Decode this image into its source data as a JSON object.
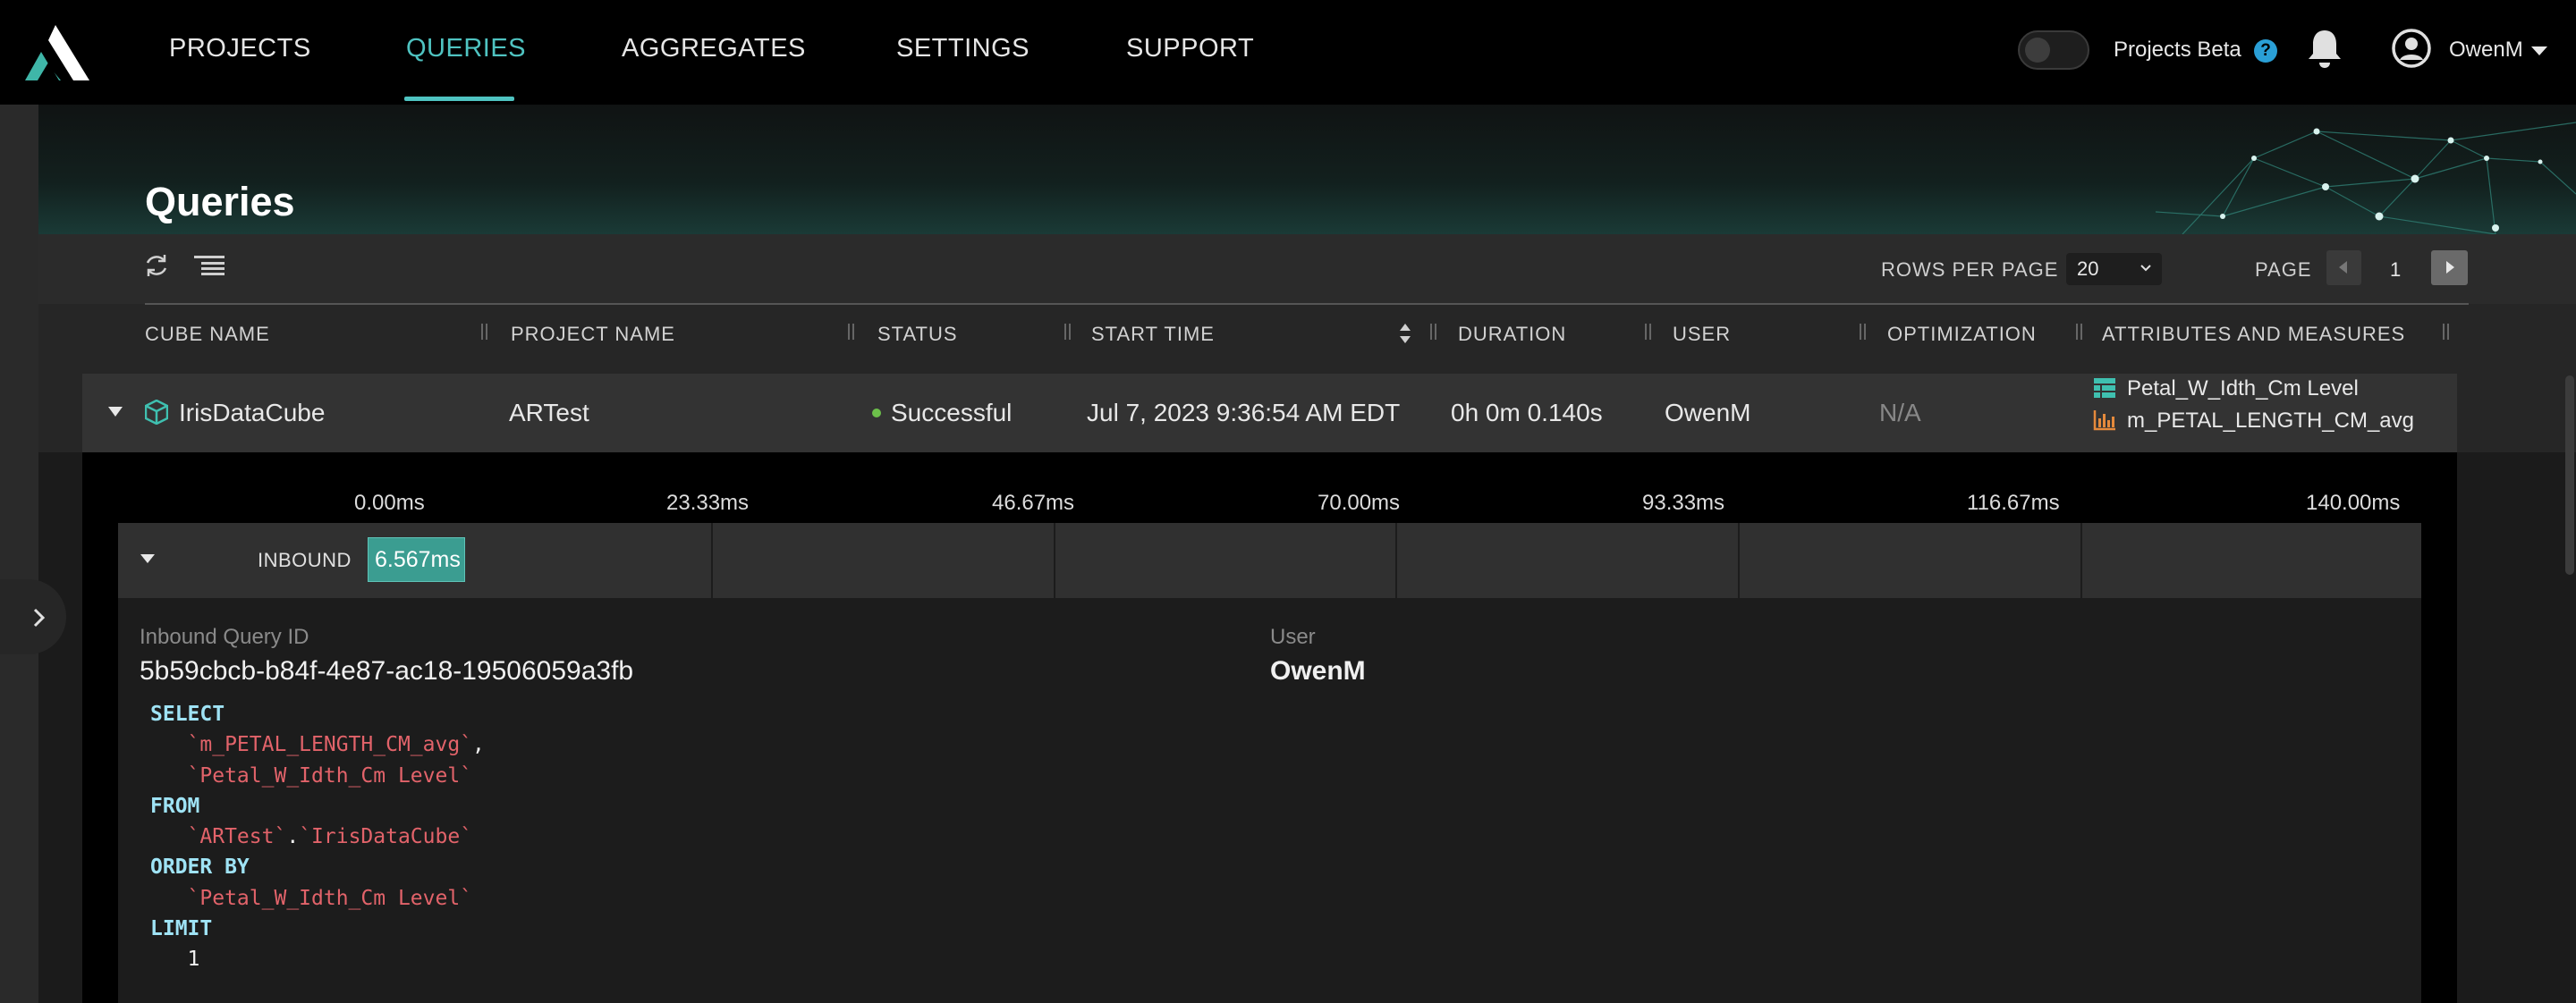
{
  "nav": {
    "items": [
      "PROJECTS",
      "QUERIES",
      "AGGREGATES",
      "SETTINGS",
      "SUPPORT"
    ],
    "active": "QUERIES",
    "beta_label": "Projects Beta",
    "help_glyph": "?",
    "username": "OwenM",
    "icons": [
      "logo-icon",
      "help-icon",
      "bell-icon",
      "avatar-icon",
      "caret-down-icon"
    ]
  },
  "page": {
    "title": "Queries"
  },
  "toolbar": {
    "rows_per_page_label": "ROWS PER PAGE",
    "rows_per_page_value": "20",
    "page_label": "PAGE",
    "page_number": "1",
    "icons": [
      "refresh-icon",
      "columns-icon"
    ]
  },
  "table": {
    "columns": [
      "CUBE NAME",
      "PROJECT NAME",
      "STATUS",
      "START TIME",
      "DURATION",
      "USER",
      "OPTIMIZATION",
      "ATTRIBUTES AND MEASURES"
    ],
    "row": {
      "cube_name": "IrisDataCube",
      "project_name": "ARTest",
      "status": "Successful",
      "start_time": "Jul 7, 2023 9:36:54 AM EDT",
      "duration": "0h 0m 0.140s",
      "user": "OwenM",
      "optimization": "N/A",
      "attributes": [
        "Petal_W_Idth_Cm Level",
        "m_PETAL_LENGTH_CM_avg"
      ]
    }
  },
  "colors": {
    "accent": "#4fc3c1",
    "status_success": "#6cc04a",
    "timeline_bar": "#3b9d91",
    "sql_keyword": "#9fe3f5",
    "sql_identifier": "#e2636a"
  },
  "timeline": {
    "ticks": [
      "0.00ms",
      "23.33ms",
      "46.67ms",
      "70.00ms",
      "93.33ms",
      "116.67ms",
      "140.00ms"
    ],
    "phase_label": "INBOUND",
    "phase_duration": "6.567ms"
  },
  "detail": {
    "query_id_label": "Inbound Query ID",
    "query_id": "5b59cbcb-b84f-4e87-ac18-19506059a3fb",
    "user_label": "User",
    "user": "OwenM",
    "sql": {
      "select": "SELECT",
      "col1": "`m_PETAL_LENGTH_CM_avg`",
      "comma": ",",
      "col2": "`Petal_W_Idth_Cm Level`",
      "from": "FROM",
      "schema": "`ARTest`",
      "dot": ".",
      "table": "`IrisDataCube`",
      "order_by": "ORDER BY",
      "order_col": "`Petal_W_Idth_Cm Level`",
      "limit": "LIMIT",
      "limit_value": "1"
    }
  }
}
